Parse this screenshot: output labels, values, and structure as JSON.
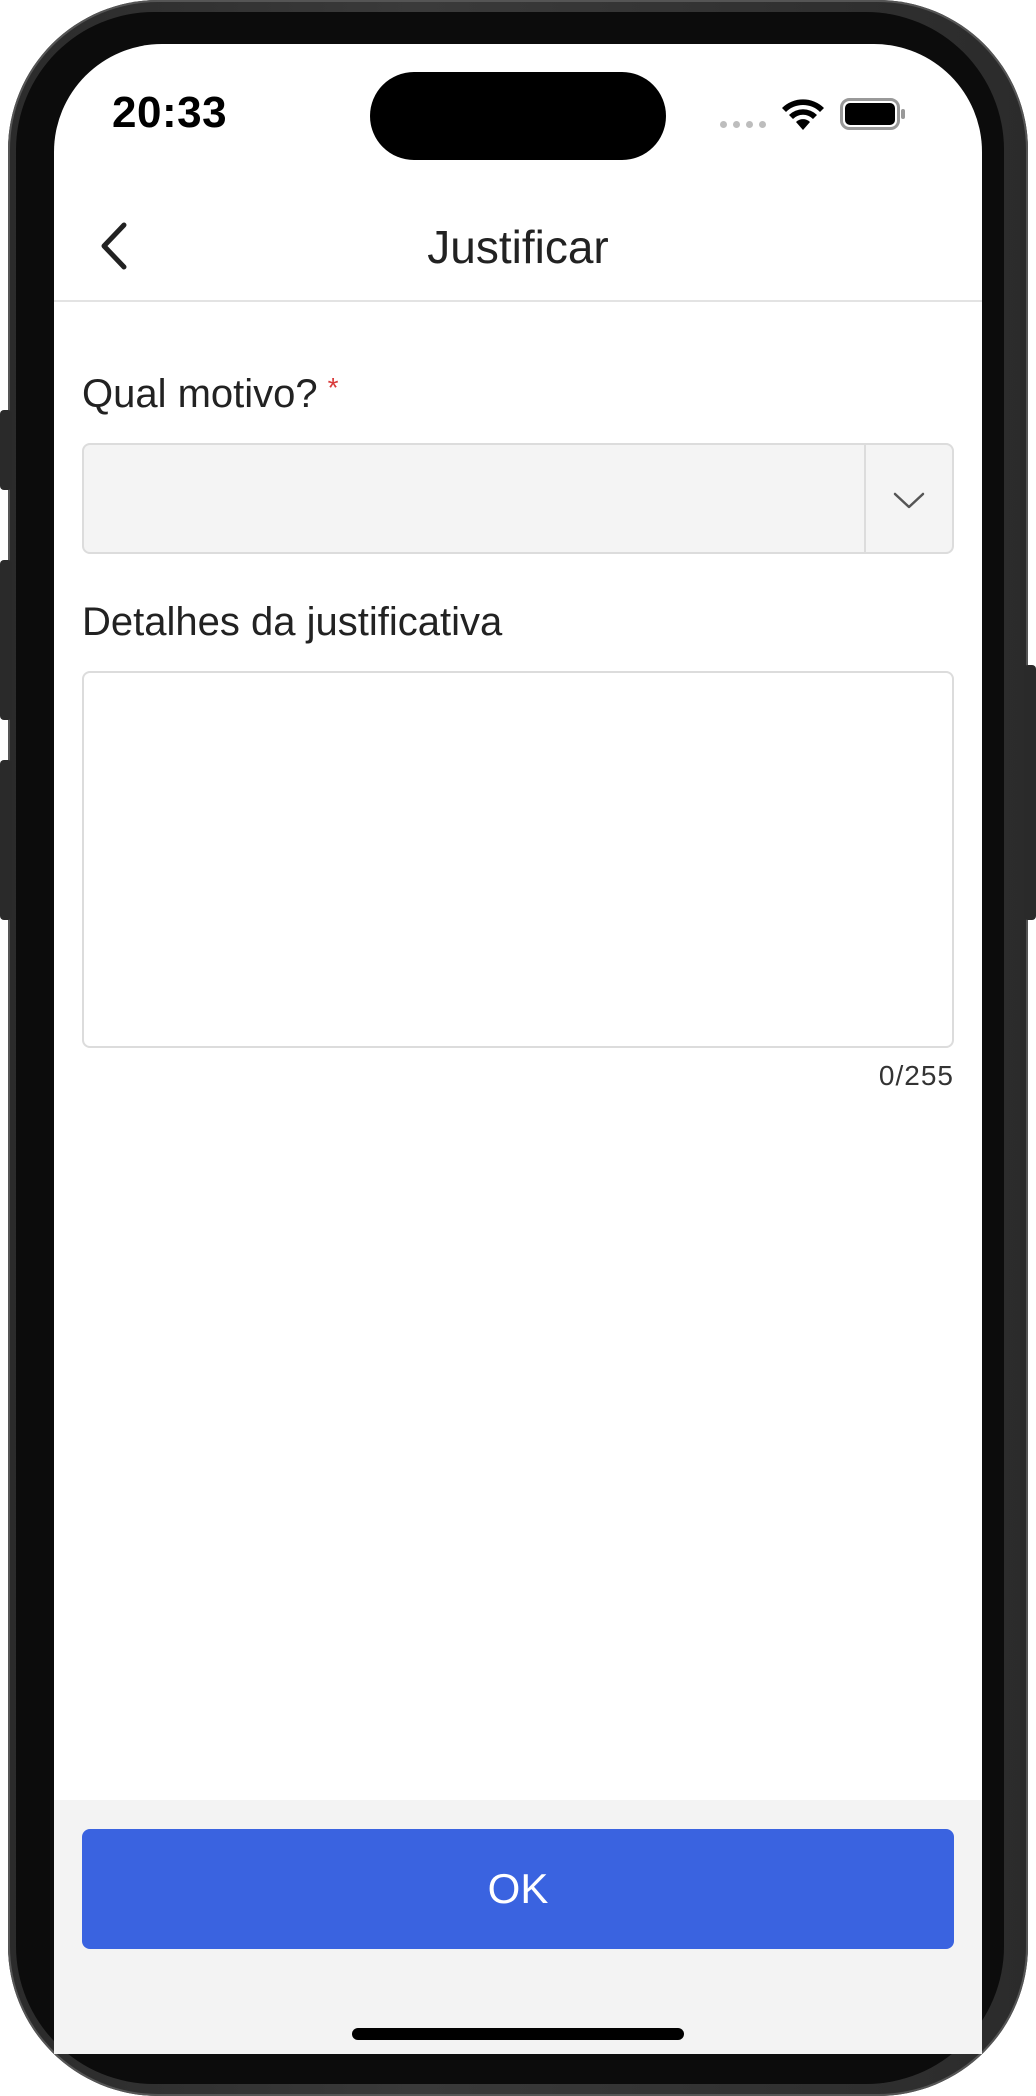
{
  "status_bar": {
    "time": "20:33"
  },
  "header": {
    "title": "Justificar",
    "back_icon": "chevron-left-icon"
  },
  "form": {
    "reason": {
      "label": "Qual motivo?",
      "required_mark": "*",
      "selected_value": "",
      "dropdown_icon": "chevron-down-icon"
    },
    "details": {
      "label": "Detalhes da justificativa",
      "value": "",
      "counter": "0/255"
    }
  },
  "footer": {
    "ok_label": "OK"
  },
  "colors": {
    "primary": "#3a63e0",
    "required": "#d93b3b",
    "background": "#ffffff",
    "footer_background": "#f3f3f3"
  }
}
